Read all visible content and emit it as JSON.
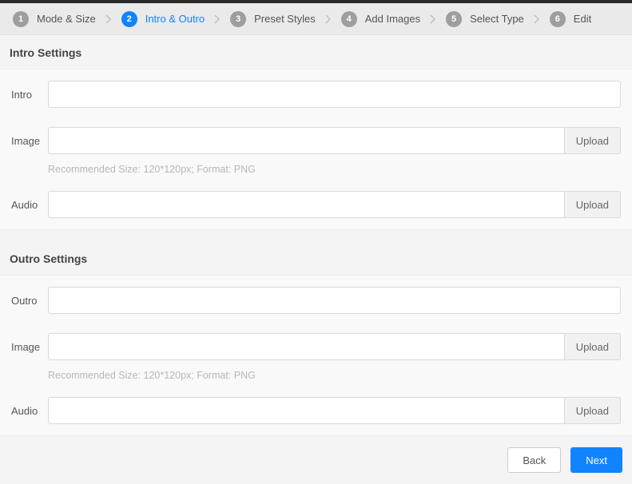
{
  "stepper": {
    "steps": [
      {
        "num": "1",
        "label": "Mode & Size",
        "active": false
      },
      {
        "num": "2",
        "label": "Intro & Outro",
        "active": true
      },
      {
        "num": "3",
        "label": "Preset Styles",
        "active": false
      },
      {
        "num": "4",
        "label": "Add Images",
        "active": false
      },
      {
        "num": "5",
        "label": "Select Type",
        "active": false
      },
      {
        "num": "6",
        "label": "Edit",
        "active": false
      }
    ]
  },
  "intro": {
    "header": "Intro Settings",
    "introLabel": "Intro",
    "introValue": "",
    "imageLabel": "Image",
    "imageValue": "",
    "imageHint": "Recommended Size: 120*120px; Format: PNG",
    "audioLabel": "Audio",
    "audioValue": "",
    "uploadLabel": "Upload"
  },
  "outro": {
    "header": "Outro Settings",
    "outroLabel": "Outro",
    "outroValue": "",
    "imageLabel": "Image",
    "imageValue": "",
    "imageHint": "Recommended Size: 120*120px; Format: PNG",
    "audioLabel": "Audio",
    "audioValue": "",
    "uploadLabel": "Upload"
  },
  "footer": {
    "back": "Back",
    "next": "Next"
  }
}
